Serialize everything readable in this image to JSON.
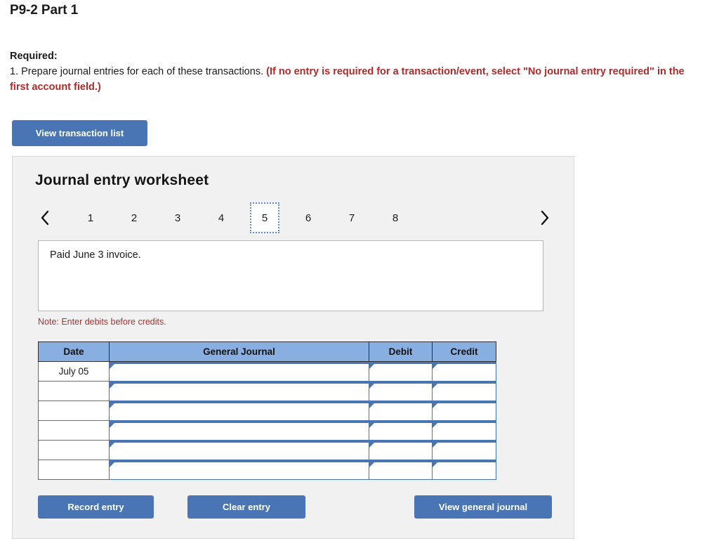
{
  "page": {
    "title": "P9-2 Part 1"
  },
  "required": {
    "label": "Required:",
    "line1": "1. Prepare journal entries for each of these transactions. ",
    "emphasis": "(If no entry is required for a transaction/event, select \"No journal entry required\" in the first account field.)"
  },
  "toolbar": {
    "view_transaction_list_label": "View transaction list"
  },
  "worksheet": {
    "title": "Journal entry worksheet",
    "prev_icon": "chevron-left-icon",
    "next_icon": "chevron-right-icon",
    "tabs": [
      {
        "label": "1",
        "selected": false
      },
      {
        "label": "2",
        "selected": false
      },
      {
        "label": "3",
        "selected": false
      },
      {
        "label": "4",
        "selected": false
      },
      {
        "label": "5",
        "selected": true
      },
      {
        "label": "6",
        "selected": false
      },
      {
        "label": "7",
        "selected": false
      },
      {
        "label": "8",
        "selected": false
      }
    ],
    "description": "Paid June 3 invoice.",
    "note": "Note: Enter debits before credits.",
    "table": {
      "headers": [
        "Date",
        "General Journal",
        "Debit",
        "Credit"
      ],
      "rows": [
        {
          "date": "July 05",
          "general_journal": "",
          "debit": "",
          "credit": ""
        },
        {
          "date": "",
          "general_journal": "",
          "debit": "",
          "credit": ""
        },
        {
          "date": "",
          "general_journal": "",
          "debit": "",
          "credit": ""
        },
        {
          "date": "",
          "general_journal": "",
          "debit": "",
          "credit": ""
        },
        {
          "date": "",
          "general_journal": "",
          "debit": "",
          "credit": ""
        },
        {
          "date": "",
          "general_journal": "",
          "debit": "",
          "credit": ""
        }
      ]
    },
    "actions": {
      "record_entry_label": "Record entry",
      "clear_entry_label": "Clear entry",
      "view_general_journal_label": "View general journal"
    }
  },
  "colors": {
    "button_blue": "#4a75b5",
    "header_blue": "#89afe0",
    "note_red": "#ac3131",
    "emphasis_red": "#b02a2a",
    "panel_gray": "#f1f1f1"
  }
}
